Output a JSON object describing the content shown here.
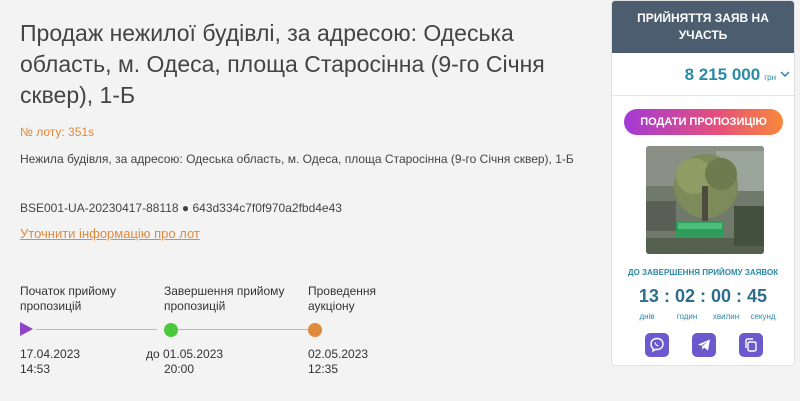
{
  "lot": {
    "title": "Продаж нежилої будівлі, за адресою: Одеська область, м. Одеса, площа Старосінна (9-го Січня сквер), 1-Б",
    "number_label": "№ лоту: 351s",
    "description": "Нежила будівля, за адресою: Одеська область, м. Одеса, площа Старосінна (9-го Січня сквер), 1-Б",
    "ids": "BSE001-UA-20230417-88118 ● 643d334c7f0f970a2fbd4e43",
    "more_info_link": "Уточнити інформацію про лот"
  },
  "timeline": {
    "stages": [
      {
        "label_line1": "Початок прийому",
        "label_line2": "пропозицій",
        "date_line1": "17.04.2023",
        "date_line2": "14:53",
        "color": "#8e44c9"
      },
      {
        "label_line1": "Завершення прийому",
        "label_line2": "пропозицій",
        "date_line1": "до 01.05.2023",
        "date_line2": "20:00",
        "color": "#4cc93a"
      },
      {
        "label_line1": "Проведення",
        "label_line2": "аукціону",
        "date_line1": "02.05.2023",
        "date_line2": "12:35",
        "color": "#e08a3c"
      }
    ]
  },
  "panel": {
    "header": "Прийняття заяв на участь",
    "price": "8 215 000",
    "currency": "грн",
    "offer_button": "Подати пропозицію",
    "countdown_label": "до завершення прийому заявок",
    "countdown": {
      "days": "13",
      "hours": "02",
      "minutes": "00",
      "seconds": "45"
    },
    "countdown_units": {
      "days": "днів",
      "hours": "годин",
      "minutes": "хвилин",
      "seconds": "секунд"
    },
    "share_icons": [
      "viber-icon",
      "telegram-icon",
      "copy-icon"
    ]
  },
  "colors": {
    "accent": "#e08a3c",
    "header_bg": "#4b5d6e",
    "price": "#2b8aa6"
  }
}
